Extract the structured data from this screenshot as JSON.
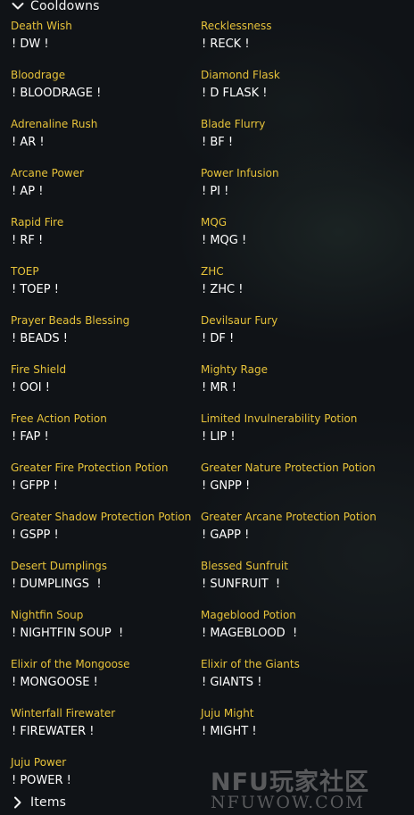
{
  "sections": {
    "cooldowns_label": "Cooldowns",
    "items_label": "Items"
  },
  "cooldowns": [
    {
      "name": "Death Wish",
      "macro": "! DW !"
    },
    {
      "name": "Recklessness",
      "macro": "! RECK !"
    },
    {
      "name": "Bloodrage",
      "macro": "! BLOODRAGE !"
    },
    {
      "name": "Diamond Flask",
      "macro": "! D FLASK !"
    },
    {
      "name": "Adrenaline Rush",
      "macro": "! AR !"
    },
    {
      "name": "Blade Flurry",
      "macro": "! BF !"
    },
    {
      "name": "Arcane Power",
      "macro": "! AP !"
    },
    {
      "name": "Power Infusion",
      "macro": "! PI !"
    },
    {
      "name": "Rapid Fire",
      "macro": "! RF !"
    },
    {
      "name": "MQG",
      "macro": "! MQG !"
    },
    {
      "name": "TOEP",
      "macro": "! TOEP !"
    },
    {
      "name": "ZHC",
      "macro": "! ZHC !"
    },
    {
      "name": "Prayer Beads Blessing",
      "macro": "! BEADS !"
    },
    {
      "name": "Devilsaur Fury",
      "macro": "! DF !"
    },
    {
      "name": "Fire Shield",
      "macro": "! OOI !"
    },
    {
      "name": "Mighty Rage",
      "macro": "! MR !"
    },
    {
      "name": "Free Action Potion",
      "macro": "! FAP !"
    },
    {
      "name": "Limited Invulnerability Potion",
      "macro": "! LIP !"
    },
    {
      "name": "Greater Fire Protection Potion",
      "macro": "! GFPP !"
    },
    {
      "name": "Greater Nature Protection Potion",
      "macro": "! GNPP !"
    },
    {
      "name": "Greater Shadow Protection Potion",
      "macro": "! GSPP !"
    },
    {
      "name": "Greater Arcane Protection Potion",
      "macro": "! GAPP !"
    },
    {
      "name": "Desert Dumplings",
      "macro": "! DUMPLINGS  !"
    },
    {
      "name": "Blessed Sunfruit",
      "macro": "! SUNFRUIT  !"
    },
    {
      "name": "Nightfin Soup",
      "macro": "! NIGHTFIN SOUP  !"
    },
    {
      "name": "Mageblood Potion",
      "macro": "! MAGEBLOOD  !"
    },
    {
      "name": "Elixir of the Mongoose",
      "macro": "! MONGOOSE !"
    },
    {
      "name": "Elixir of the Giants",
      "macro": "! GIANTS !"
    },
    {
      "name": "Winterfall Firewater",
      "macro": "! FIREWATER !"
    },
    {
      "name": "Juju Might",
      "macro": "! MIGHT !"
    },
    {
      "name": "Juju Power",
      "macro": "! POWER !"
    }
  ],
  "icons": {
    "expanded": "chevron-down-icon",
    "collapsed": "chevron-right-icon"
  },
  "watermark": {
    "top": "NFU玩家社区",
    "bottom": "NFUWOW.COM"
  },
  "colors": {
    "label": "#e6c23a",
    "value": "#ffffff",
    "background": "#101317"
  }
}
